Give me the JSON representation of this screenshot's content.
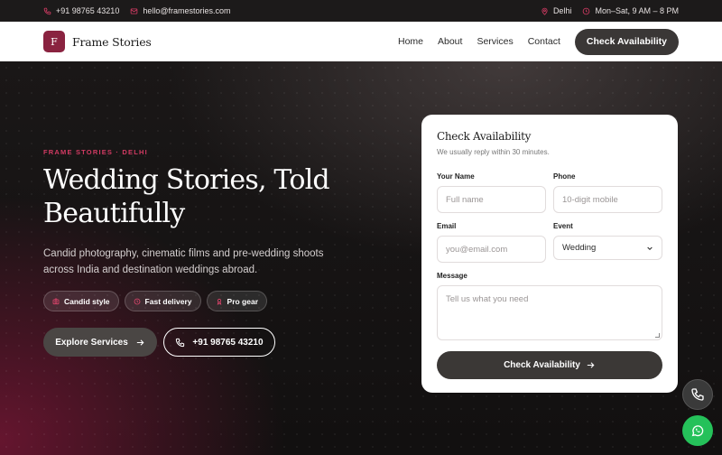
{
  "topbar": {
    "phone": "+91 98765 43210",
    "email": "hello@framestories.com",
    "location": "Delhi",
    "hours": "Mon–Sat, 9 AM – 8 PM"
  },
  "nav": {
    "logo_letter": "F",
    "brand": "Frame Stories",
    "links": [
      "Home",
      "About",
      "Services",
      "Contact"
    ],
    "cta": "Check Availability"
  },
  "hero": {
    "eyebrow": "FRAME STORIES · DELHI",
    "headline": "Wedding Stories, Told Beautifully",
    "lede": "Candid photography, cinematic films and pre-wedding shoots across India and destination weddings abroad.",
    "chips": [
      "Candid style",
      "Fast delivery",
      "Pro gear"
    ],
    "primary_btn": "Explore Services",
    "phone_btn": "+91 98765 43210"
  },
  "form": {
    "title": "Check Availability",
    "subtitle": "We usually reply within 30 minutes.",
    "name_label": "Your Name",
    "name_placeholder": "Full name",
    "phone_label": "Phone",
    "phone_placeholder": "10-digit mobile",
    "email_label": "Email",
    "email_placeholder": "you@email.com",
    "event_label": "Event",
    "event_value": "Wedding",
    "message_label": "Message",
    "message_placeholder": "Tell us what you need",
    "submit": "Check Availability"
  },
  "colors": {
    "accent": "#d23b63",
    "brand": "#8a2340",
    "dark_button": "#3b3836",
    "whatsapp": "#25c15a"
  },
  "icons": {
    "phone": "phone-icon",
    "email": "mail-icon",
    "location": "map-pin-icon",
    "hours": "clock-icon",
    "arrow": "arrow-right-icon",
    "whatsapp": "whatsapp-icon"
  }
}
